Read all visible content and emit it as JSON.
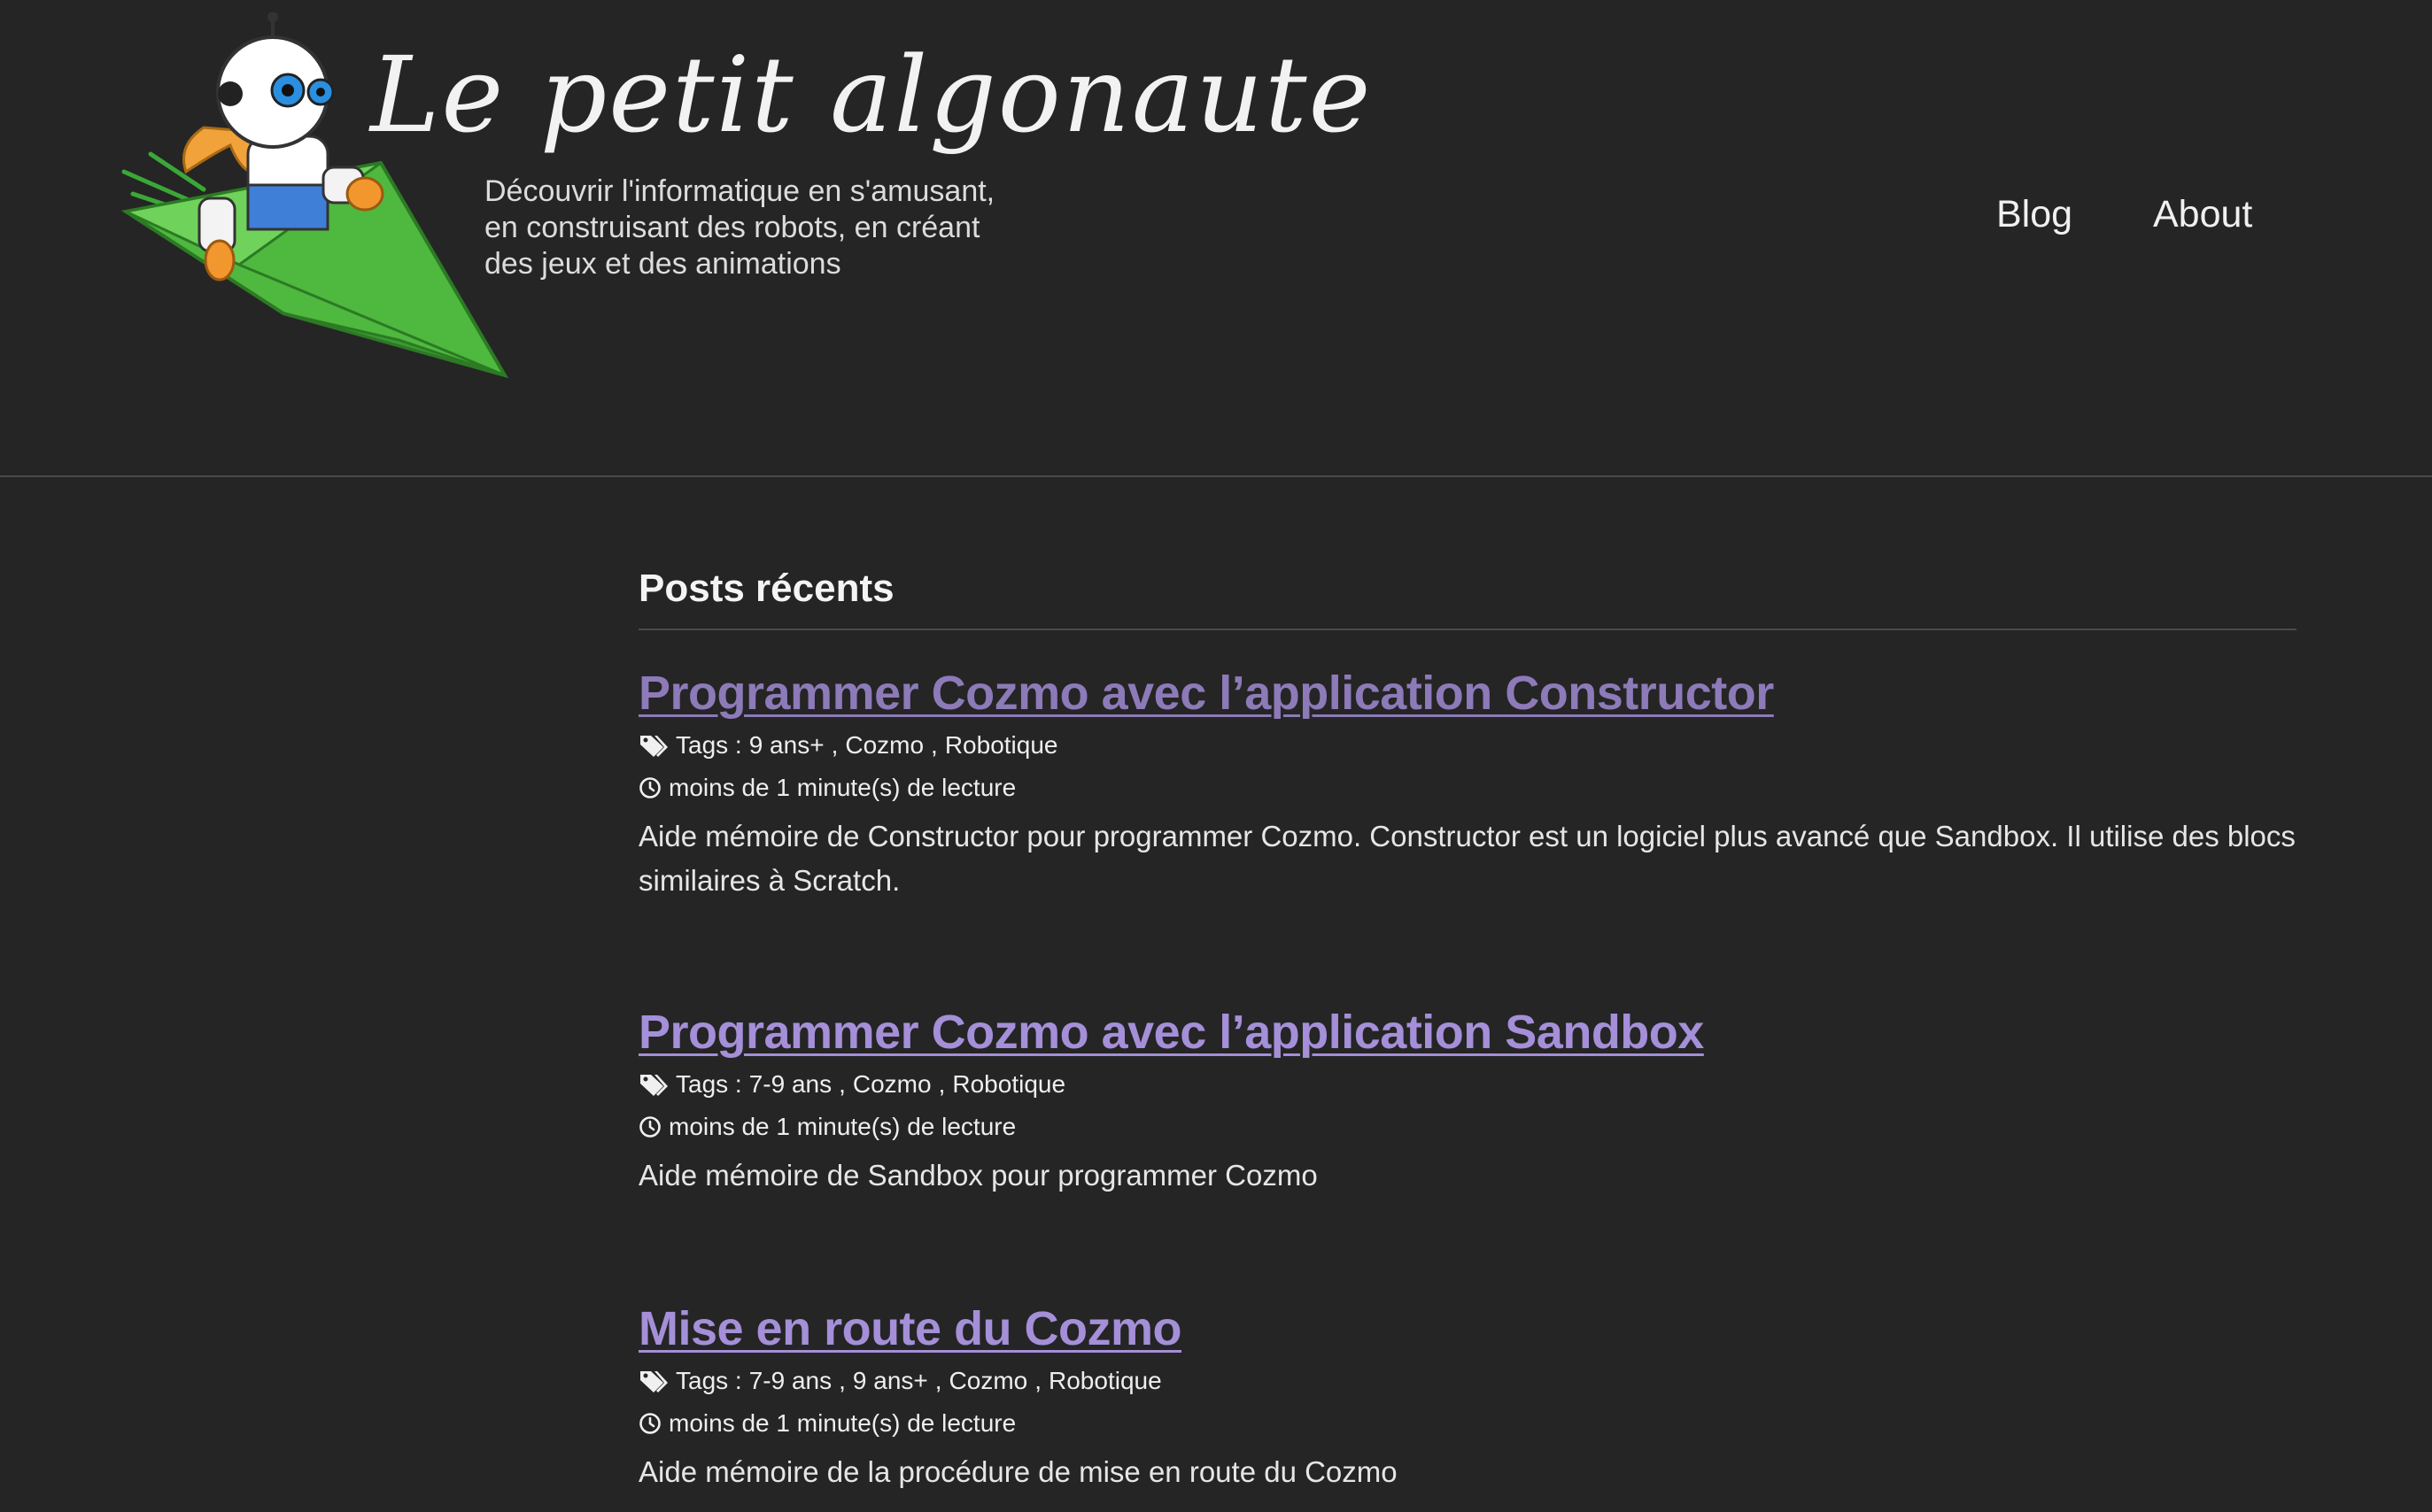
{
  "site": {
    "title": "Le petit algonaute",
    "tagline": [
      "Découvrir l'informatique en s'amusant,",
      "en construisant des robots, en créant",
      "des jeux et des animations"
    ],
    "logo_icon": "robot-on-paper-plane-icon"
  },
  "nav": {
    "blog": "Blog",
    "about": "About"
  },
  "main": {
    "section_title": "Posts récents",
    "posts": [
      {
        "title": "Programmer Cozmo avec l’application Constructor",
        "tags_label": "Tags :",
        "tags": [
          "9 ans+",
          "Cozmo",
          "Robotique"
        ],
        "reading_time": "moins de 1 minute(s) de lecture",
        "excerpt": "Aide mémoire de Constructor pour programmer Cozmo. Constructor est un logiciel plus avancé que Sandbox. Il utilise des blocs similaires à Scratch.",
        "visited": true
      },
      {
        "title": "Programmer Cozmo avec l’application Sandbox",
        "tags_label": "Tags :",
        "tags": [
          "7-9 ans",
          "Cozmo",
          "Robotique"
        ],
        "reading_time": "moins de 1 minute(s) de lecture",
        "excerpt": "Aide mémoire de Sandbox pour programmer Cozmo",
        "visited": false
      },
      {
        "title": "Mise en route du Cozmo",
        "tags_label": "Tags :",
        "tags": [
          "7-9 ans",
          "9 ans+",
          "Cozmo",
          "Robotique"
        ],
        "reading_time": "moins de 1 minute(s) de lecture",
        "excerpt": "Aide mémoire de la procédure de mise en route du Cozmo",
        "visited": false
      }
    ]
  },
  "colors": {
    "background": "#252525",
    "link": "#a48fd8",
    "link_visited": "#8d7ab8",
    "text": "#eaeaea",
    "divider": "#4a4a4a"
  }
}
